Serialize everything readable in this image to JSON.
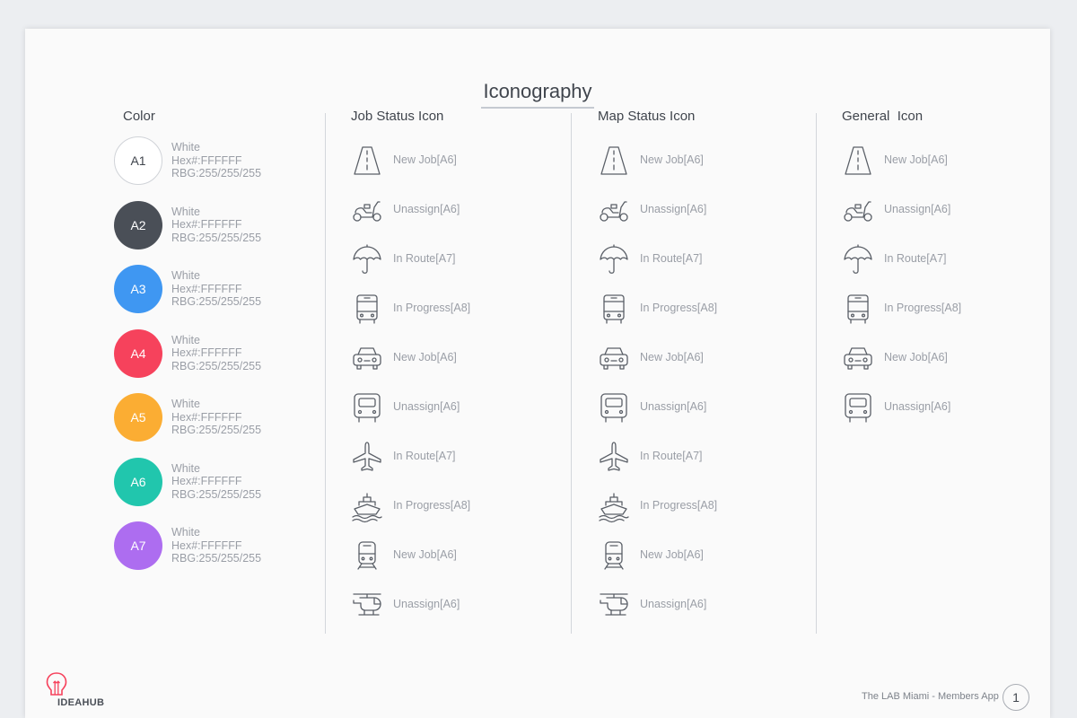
{
  "page": {
    "title": "Iconography"
  },
  "columns": {
    "color": "Color",
    "job_status": "Job Status Icon",
    "map_status": "Map Status Icon",
    "general": "General  Icon"
  },
  "colors": [
    {
      "code": "A1",
      "hex_color": "#ffffff",
      "name": "White",
      "hex": "Hex#:FFFFFF",
      "rgb": "RBG:255/255/255"
    },
    {
      "code": "A2",
      "hex_color": "#4a4f57",
      "name": "White",
      "hex": "Hex#:FFFFFF",
      "rgb": "RBG:255/255/255"
    },
    {
      "code": "A3",
      "hex_color": "#3f97f2",
      "name": "White",
      "hex": "Hex#:FFFFFF",
      "rgb": "RBG:255/255/255"
    },
    {
      "code": "A4",
      "hex_color": "#f6425c",
      "name": "White",
      "hex": "Hex#:FFFFFF",
      "rgb": "RBG:255/255/255"
    },
    {
      "code": "A5",
      "hex_color": "#fbad33",
      "name": "White",
      "hex": "Hex#:FFFFFF",
      "rgb": "RBG:255/255/255"
    },
    {
      "code": "A6",
      "hex_color": "#21c6ad",
      "name": "White",
      "hex": "Hex#:FFFFFF",
      "rgb": "RBG:255/255/255"
    },
    {
      "code": "A7",
      "hex_color": "#ad6df0",
      "name": "White",
      "hex": "Hex#:FFFFFF",
      "rgb": "RBG:255/255/255"
    }
  ],
  "job_icons": [
    {
      "icon": "road-icon",
      "label": "New Job[A6]"
    },
    {
      "icon": "scooter-icon",
      "label": "Unassign[A6]"
    },
    {
      "icon": "umbrella-icon",
      "label": "In Route[A7]"
    },
    {
      "icon": "bus-icon",
      "label": "In Progress[A8]"
    },
    {
      "icon": "car-icon",
      "label": "New Job[A6]"
    },
    {
      "icon": "truck-icon",
      "label": "Unassign[A6]"
    },
    {
      "icon": "airplane-icon",
      "label": "In Route[A7]"
    },
    {
      "icon": "ship-icon",
      "label": "In Progress[A8]"
    },
    {
      "icon": "train-icon",
      "label": "New Job[A6]"
    },
    {
      "icon": "helicopter-icon",
      "label": "Unassign[A6]"
    }
  ],
  "map_icons": [
    {
      "icon": "road-icon",
      "label": "New Job[A6]"
    },
    {
      "icon": "scooter-icon",
      "label": "Unassign[A6]"
    },
    {
      "icon": "umbrella-icon",
      "label": "In Route[A7]"
    },
    {
      "icon": "bus-icon",
      "label": "In Progress[A8]"
    },
    {
      "icon": "car-icon",
      "label": "New Job[A6]"
    },
    {
      "icon": "truck-icon",
      "label": "Unassign[A6]"
    },
    {
      "icon": "airplane-icon",
      "label": "In Route[A7]"
    },
    {
      "icon": "ship-icon",
      "label": "In Progress[A8]"
    },
    {
      "icon": "train-icon",
      "label": "New Job[A6]"
    },
    {
      "icon": "helicopter-icon",
      "label": "Unassign[A6]"
    }
  ],
  "general_icons": [
    {
      "icon": "road-icon",
      "label": "New Job[A6]"
    },
    {
      "icon": "scooter-icon",
      "label": "Unassign[A6]"
    },
    {
      "icon": "umbrella-icon",
      "label": "In Route[A7]"
    },
    {
      "icon": "bus-icon",
      "label": "In Progress[A8]"
    },
    {
      "icon": "car-icon",
      "label": "New Job[A6]"
    },
    {
      "icon": "truck-icon",
      "label": "Unassign[A6]"
    }
  ],
  "footer": {
    "logo_text": "IDEAHUB",
    "app_name": "The LAB Miami - Members App",
    "page_number": "1",
    "logo_color": "#f6425c",
    "icon_color": "#5a5f67"
  }
}
